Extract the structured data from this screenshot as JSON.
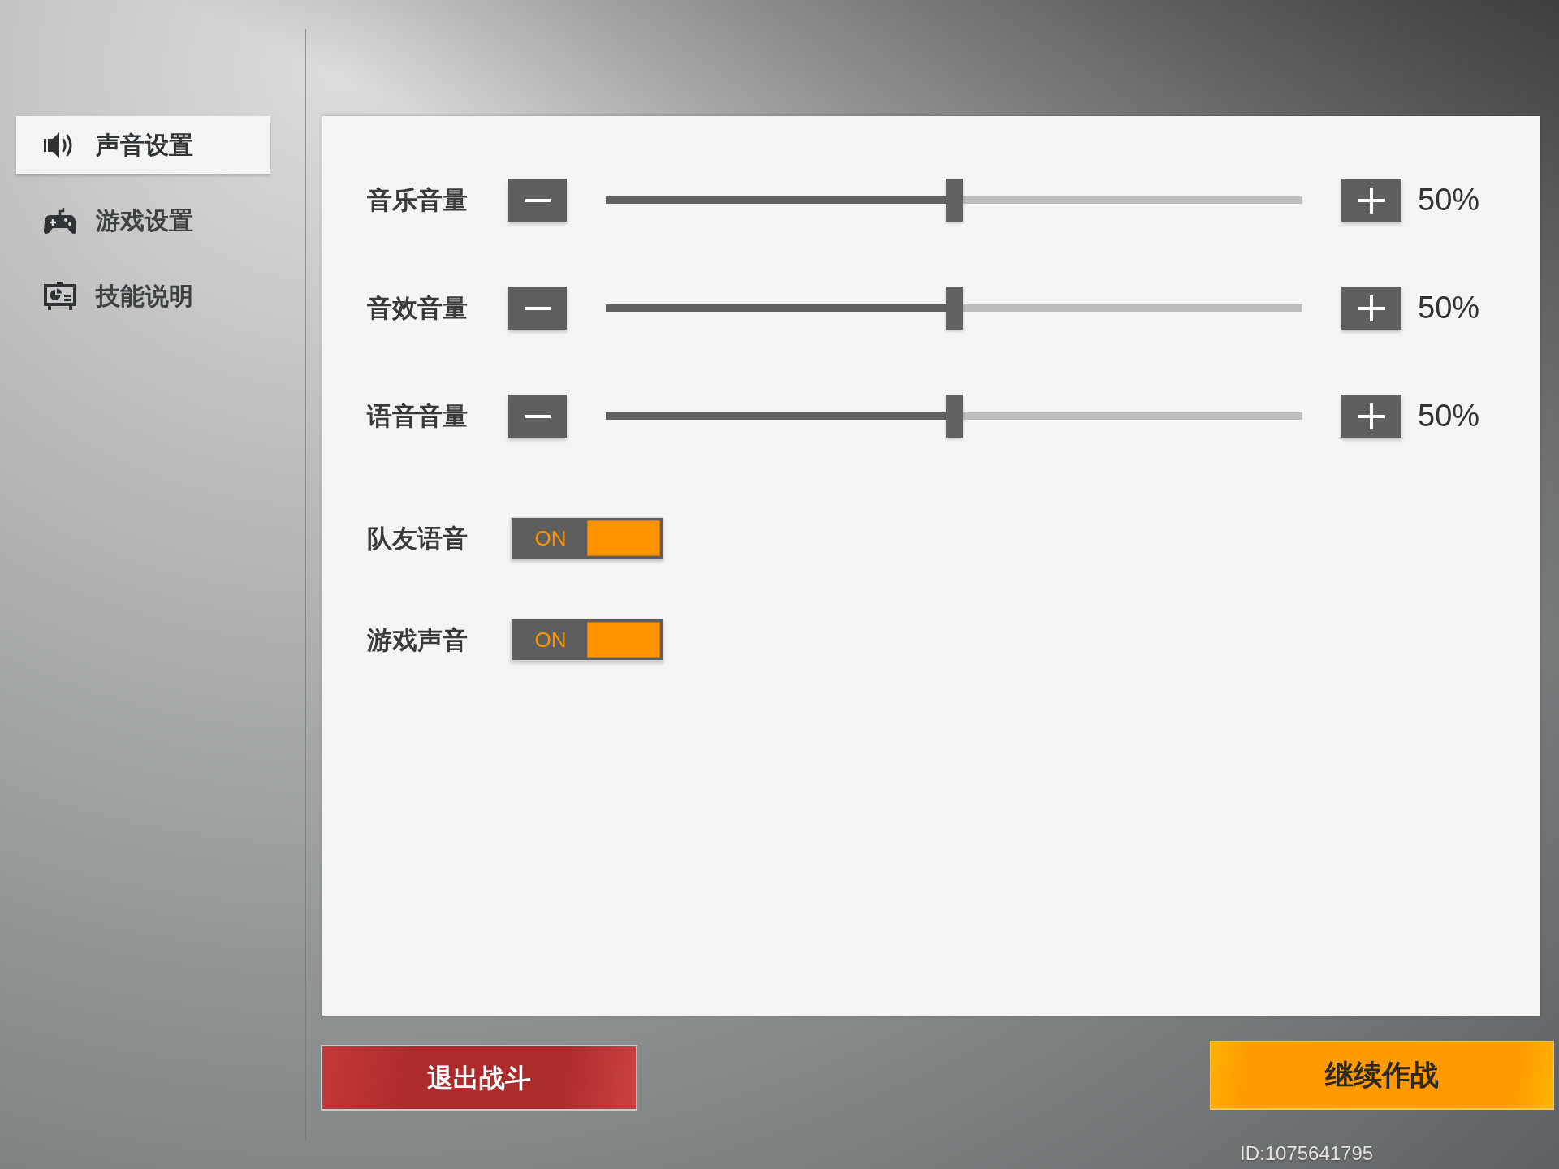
{
  "sidebar": {
    "items": [
      {
        "label": "声音设置",
        "selected": true
      },
      {
        "label": "游戏设置",
        "selected": false
      },
      {
        "label": "技能说明",
        "selected": false
      }
    ]
  },
  "volume_sliders": [
    {
      "label": "音乐音量",
      "level": 0.5,
      "reading": "50%"
    },
    {
      "label": "音效音量",
      "level": 0.5,
      "reading": "50%"
    },
    {
      "label": "语音音量",
      "level": 0.5,
      "reading": "50%"
    }
  ],
  "toggles": [
    {
      "label": "队友语音",
      "on": true,
      "state_text": "ON"
    },
    {
      "label": "游戏声音",
      "on": true,
      "state_text": "ON"
    }
  ],
  "buttons": [
    {
      "label": "退出战斗",
      "kind": "exit"
    },
    {
      "label": "继续作战",
      "kind": "continue"
    }
  ],
  "player_id": "ID:1075641795"
}
